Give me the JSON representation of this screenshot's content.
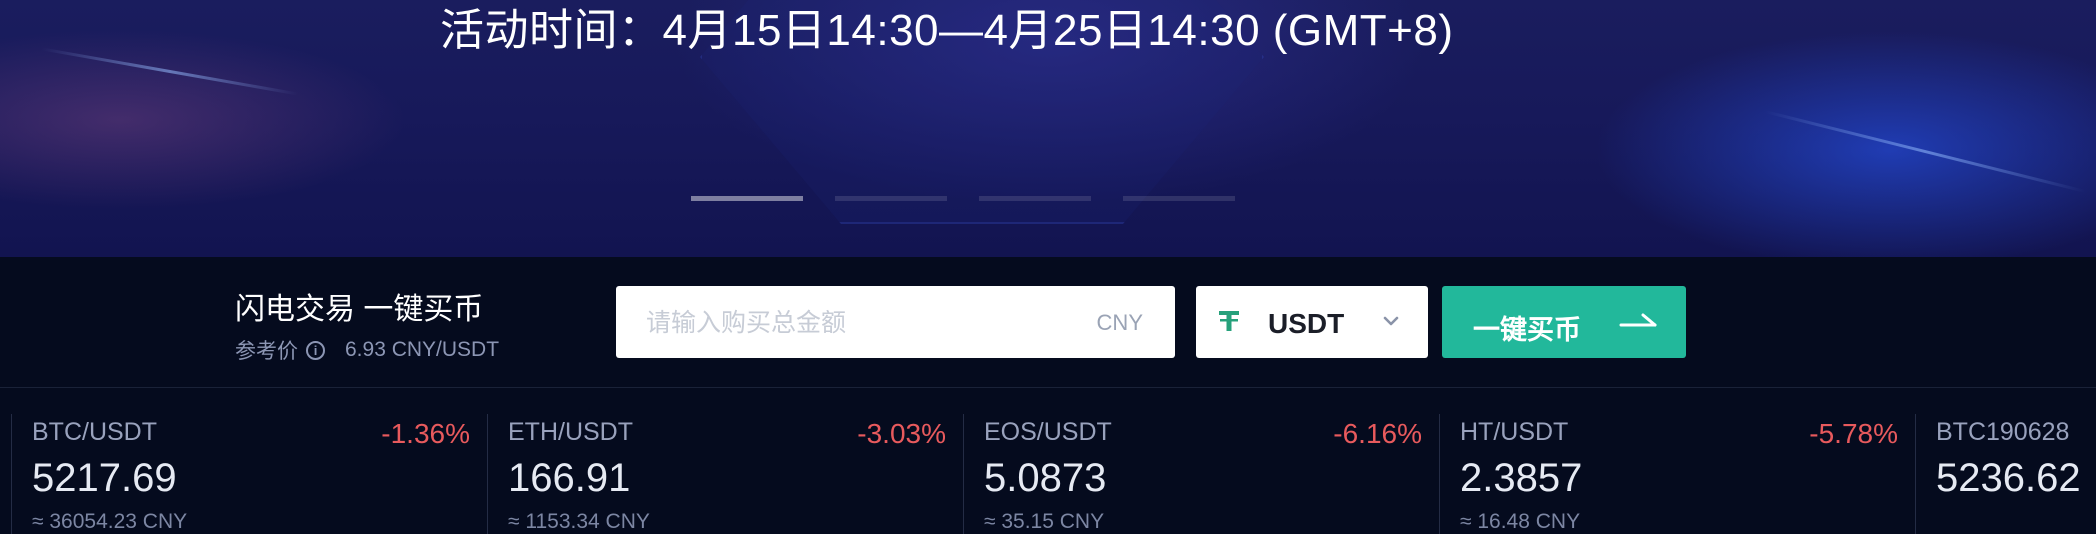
{
  "banner": {
    "event_time": "活动时间：4月15日14:30—4月25日14:30 (GMT+8)",
    "active_slide": 1,
    "slide_count": 4
  },
  "quick_buy": {
    "title": "闪电交易 一键买币",
    "ref_label": "参考价",
    "info_icon": "info-circle-icon",
    "ref_price": "6.93 CNY/USDT",
    "amount_placeholder": "请输入购买总金额",
    "amount_value": "",
    "amount_unit": "CNY",
    "currency_icon": "tether-icon",
    "currency": "USDT",
    "buy_label": "一键买币",
    "accent_color": "#22b89b"
  },
  "tickers": [
    {
      "pair": "BTC/USDT",
      "change": "-1.36%",
      "price": "5217.69",
      "cny": "≈ 36054.23 CNY"
    },
    {
      "pair": "ETH/USDT",
      "change": "-3.03%",
      "price": "166.91",
      "cny": "≈ 1153.34 CNY"
    },
    {
      "pair": "EOS/USDT",
      "change": "-6.16%",
      "price": "5.0873",
      "cny": "≈ 35.15 CNY"
    },
    {
      "pair": "HT/USDT",
      "change": "-5.78%",
      "price": "2.3857",
      "cny": "≈ 16.48 CNY"
    },
    {
      "pair": "BTC190628",
      "change": "",
      "price": "5236.62",
      "cny": ""
    }
  ],
  "colors": {
    "negative": "#e85a5d",
    "background": "#050b1e"
  }
}
